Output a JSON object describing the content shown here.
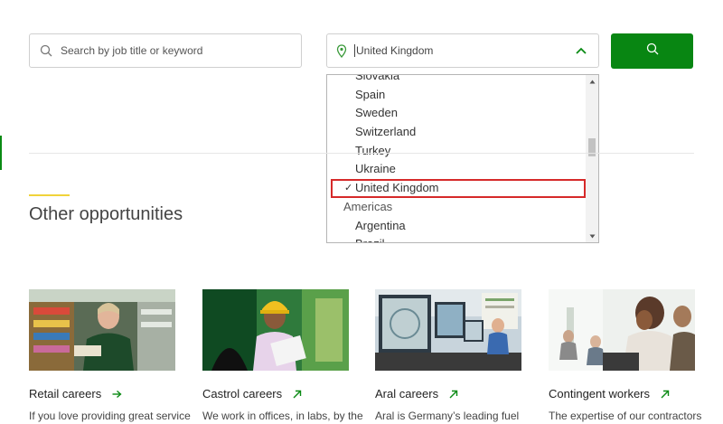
{
  "search": {
    "placeholder": "Search by job title or keyword",
    "icon": "search-icon"
  },
  "location": {
    "value": "United Kingdom",
    "icon": "location-pin-icon"
  },
  "search_button": {
    "icon": "search-icon",
    "color": "#088612"
  },
  "dropdown": {
    "options": [
      {
        "label": "Slovakia",
        "type": "option"
      },
      {
        "label": "Spain",
        "type": "option"
      },
      {
        "label": "Sweden",
        "type": "option"
      },
      {
        "label": "Switzerland",
        "type": "option"
      },
      {
        "label": "Turkey",
        "type": "option"
      },
      {
        "label": "Ukraine",
        "type": "option"
      },
      {
        "label": "United Kingdom",
        "type": "option",
        "selected": true,
        "check": "✓"
      },
      {
        "label": "Americas",
        "type": "group"
      },
      {
        "label": "Argentina",
        "type": "option"
      },
      {
        "label": "Brazil",
        "type": "option"
      }
    ],
    "highlight_color": "#d62a2a"
  },
  "section": {
    "title": "Other opportunities"
  },
  "cards": [
    {
      "title": "Retail careers",
      "desc": "If you love providing great service"
    },
    {
      "title": "Castrol careers",
      "desc": "We work in offices, in labs, by the"
    },
    {
      "title": "Aral careers",
      "desc": "Aral is Germany’s leading fuel"
    },
    {
      "title": "Contingent workers",
      "desc": "The expertise of our contractors"
    }
  ],
  "colors": {
    "brand_green": "#088612",
    "accent_yellow": "#f0d33a"
  }
}
